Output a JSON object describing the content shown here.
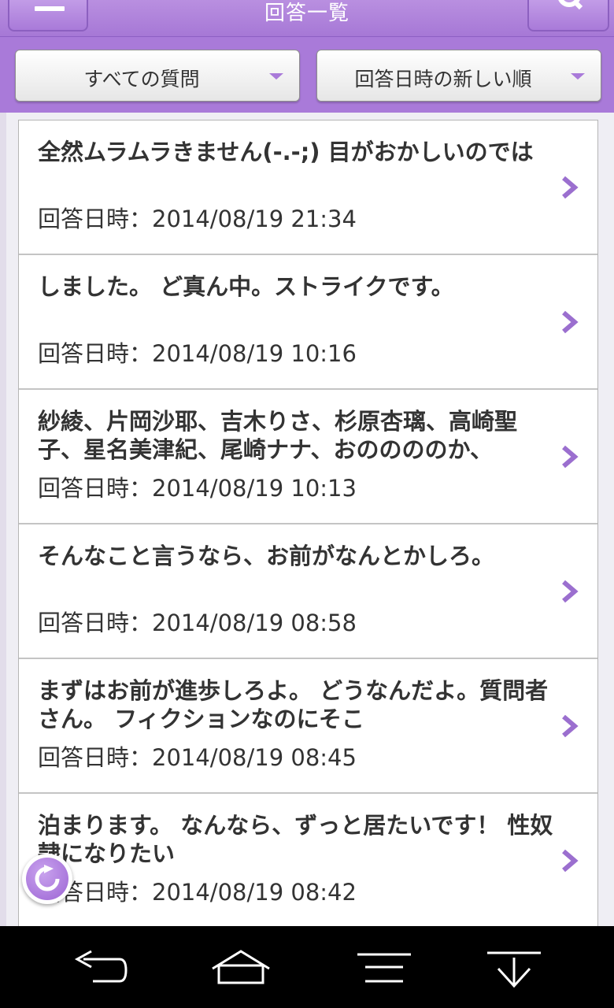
{
  "header": {
    "title": "回答一覧",
    "menu_icon": "hamburger-icon",
    "search_icon": "search-icon"
  },
  "filters": {
    "category": "すべての質問",
    "sort": "回答日時の新しい順"
  },
  "answers": [
    {
      "text": "全然ムラムラきません(-.-;)  目がおかしいのでは",
      "date": "回答日時：2014/08/19 21:34"
    },
    {
      "text": "しました。  ど真ん中。ストライクです。",
      "date": "回答日時：2014/08/19 10:16"
    },
    {
      "text": "紗綾、片岡沙耶、吉木りさ、杉原杏璃、高崎聖子、星名美津紀、尾崎ナナ、おののののか、",
      "date": "回答日時：2014/08/19 10:13"
    },
    {
      "text": "そんなこと言うなら、お前がなんとかしろ。",
      "date": "回答日時：2014/08/19 08:58"
    },
    {
      "text": "まずはお前が進歩しろよ。  どうなんだよ。質問者さん。  フィクションなのにそこ",
      "date": "回答日時：2014/08/19 08:45"
    },
    {
      "text": "泊まります。  なんなら、ずっと居たいです！ 性奴隷になりたい",
      "date": "回答日時：2014/08/19 08:42"
    }
  ],
  "colors": {
    "accent": "#a97ad9",
    "chevron": "#9b6fcf",
    "nav_background": "#000000"
  },
  "fab": {
    "icon": "refresh-icon"
  },
  "nav": {
    "back_icon": "back-icon",
    "home_icon": "home-icon",
    "menu_icon": "menu-lines-icon",
    "down_icon": "collapse-down-icon"
  }
}
